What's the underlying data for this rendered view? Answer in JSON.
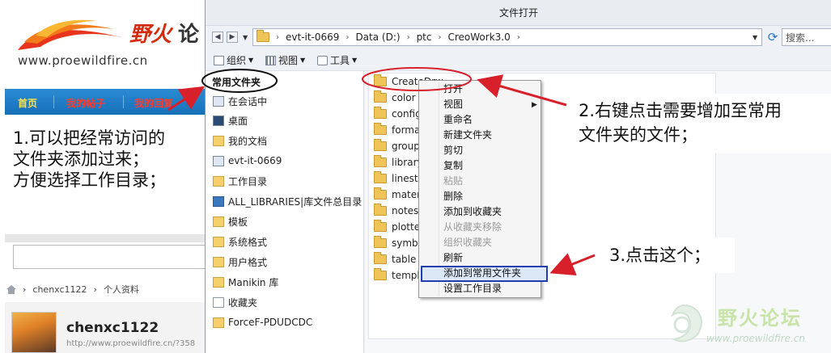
{
  "site": {
    "logo_text": "野火",
    "logo_text_2": "论",
    "logo_url": "www.proewildfire.cn",
    "nav": [
      "首页",
      "我的帖子",
      "我的回复"
    ],
    "annotation1": [
      "1.可以把经常访问的",
      "文件夹添加过来；",
      "方便选择工作目录；"
    ],
    "breadcrumb": [
      "chenxc1122",
      "个人资料"
    ],
    "user_name": "chenxc1122",
    "user_url": "http://www.proewildfire.cn/?358"
  },
  "dialog": {
    "title": "文件打开",
    "address": [
      "evt-it-0669",
      "Data (D:)",
      "ptc",
      "CreoWork3.0"
    ],
    "search_placeholder": "搜索...",
    "toolbar": {
      "organize": "组织",
      "view": "视图",
      "tools": "工具"
    },
    "favorites_header": "常用文件夹",
    "favorites": [
      "在会话中",
      "桌面",
      "我的文档",
      "evt-it-0669",
      "工作目录",
      "ALL_LIBRARIES|库文件总目录",
      "模板",
      "系统格式",
      "用户格式",
      "Manikin 库",
      "收藏夹",
      "ForceF-PDUDCDC"
    ],
    "files": [
      "CreateDrw",
      "color",
      "config",
      "format",
      "group",
      "library",
      "linesto",
      "materi",
      "notes",
      "plotter",
      "symbo",
      "table",
      "templa"
    ]
  },
  "context_menu": {
    "items": [
      {
        "label": "打开",
        "disabled": false
      },
      {
        "label": "视图",
        "disabled": false
      },
      {
        "label": "重命名",
        "disabled": false
      },
      {
        "label": "新建文件夹",
        "disabled": false
      },
      {
        "label": "剪切",
        "disabled": false
      },
      {
        "label": "复制",
        "disabled": false
      },
      {
        "label": "粘贴",
        "disabled": true
      },
      {
        "label": "删除",
        "disabled": false
      },
      {
        "label": "添加到收藏夹",
        "disabled": false
      },
      {
        "label": "从收藏夹移除",
        "disabled": true
      },
      {
        "label": "组织收藏夹",
        "disabled": true
      },
      {
        "label": "刷新",
        "disabled": false
      },
      {
        "label": "添加到常用文件夹",
        "disabled": false
      },
      {
        "label": "设置工作目录",
        "disabled": false
      }
    ]
  },
  "annotations": {
    "ann2": [
      "2.右键点击需要增加至常用",
      "文件夹的文件；"
    ],
    "ann3": "3.点击这个；"
  },
  "watermark": {
    "title": "野火论坛",
    "url": "www.proewildfire.cn"
  },
  "colors": {
    "arrow": "#d8202a",
    "highlight_border": "#1f3fb0",
    "nav_bar": "#1670b8"
  }
}
